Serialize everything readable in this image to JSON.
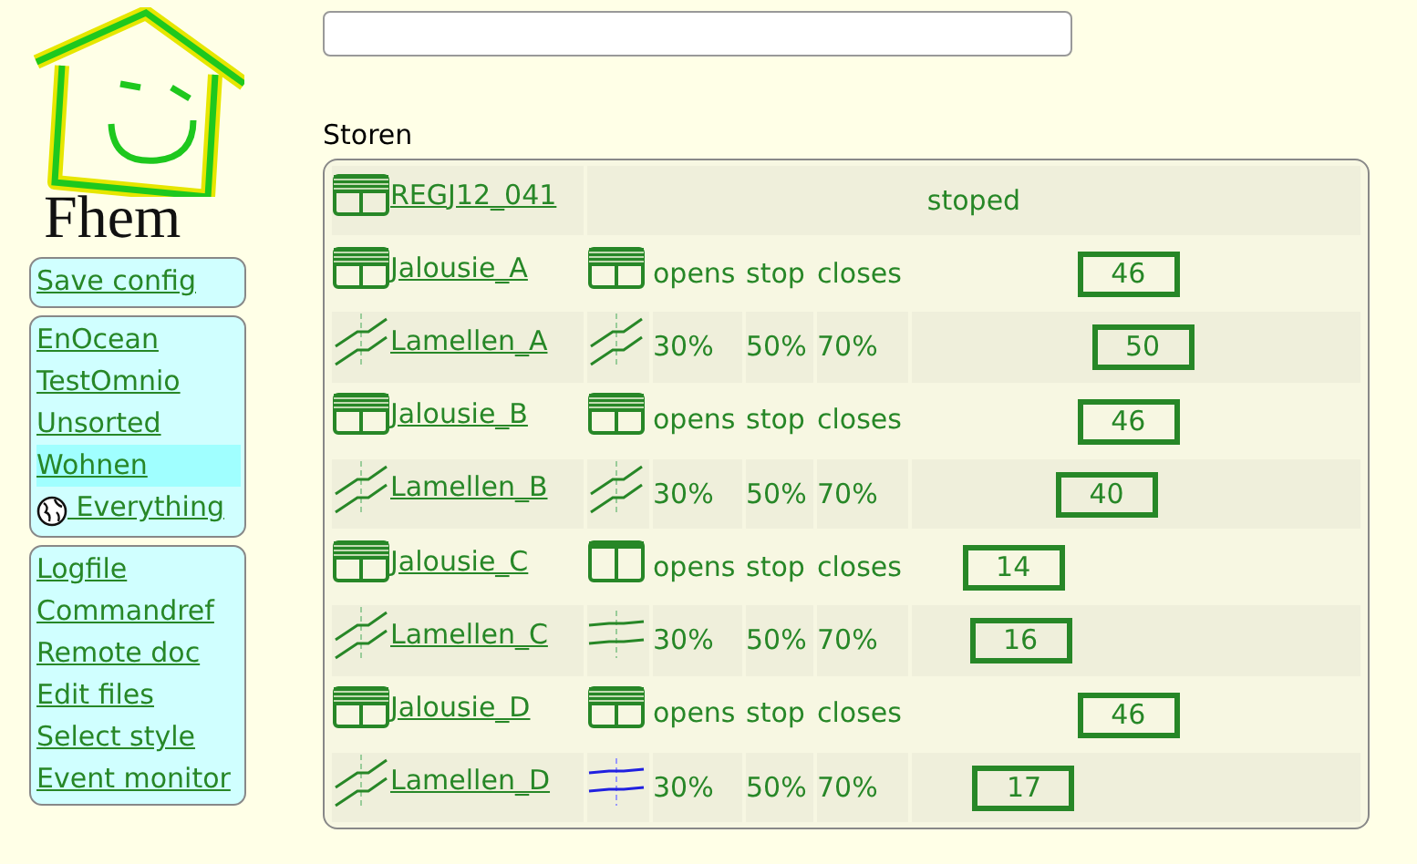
{
  "logo": {
    "text": "Fhem"
  },
  "search_field": {
    "kind": "text"
  },
  "menu_groups": [
    [
      {
        "label": "Save config",
        "kind": "link",
        "selected": false
      }
    ],
    [
      {
        "label": "EnOcean",
        "kind": "link",
        "selected": false
      },
      {
        "label": "TestOmnio",
        "kind": "link",
        "selected": false
      },
      {
        "label": "Unsorted",
        "kind": "link",
        "selected": false
      },
      {
        "label": "Wohnen",
        "kind": "link",
        "selected": true
      },
      {
        "label": " Everything",
        "kind": "globe-link",
        "selected": false
      }
    ],
    [
      {
        "label": "Logfile",
        "kind": "link",
        "selected": false
      },
      {
        "label": "Commandref",
        "kind": "link",
        "selected": false
      },
      {
        "label": "Remote doc",
        "kind": "link",
        "selected": false
      },
      {
        "label": "Edit files",
        "kind": "link",
        "selected": false
      },
      {
        "label": "Select style",
        "kind": "link",
        "selected": false
      },
      {
        "label": "Event monitor",
        "kind": "link",
        "selected": false
      }
    ]
  ],
  "room": {
    "title": "Storen",
    "rows": [
      {
        "kind": "status",
        "name": " REGJ12_041",
        "status": "stoped"
      },
      {
        "kind": "jalousie",
        "name": " Jalousie_A",
        "closed": true,
        "commands": [
          "opens",
          "stop",
          "closes"
        ],
        "slider": {
          "level": 0.46,
          "reading": "46"
        }
      },
      {
        "kind": "lamellen",
        "name": " Lamellen_A",
        "open": false,
        "moving": false,
        "commands": [
          "30%",
          "50%",
          "70%"
        ],
        "slider": {
          "level": 0.5,
          "reading": "50"
        }
      },
      {
        "kind": "jalousie",
        "name": " Jalousie_B",
        "closed": true,
        "commands": [
          "opens",
          "stop",
          "closes"
        ],
        "slider": {
          "level": 0.46,
          "reading": "46"
        }
      },
      {
        "kind": "lamellen",
        "name": " Lamellen_B",
        "open": false,
        "moving": false,
        "commands": [
          "30%",
          "50%",
          "70%"
        ],
        "slider": {
          "level": 0.4,
          "reading": "40"
        }
      },
      {
        "kind": "jalousie",
        "name": " Jalousie_C",
        "closed": false,
        "commands": [
          "opens",
          "stop",
          "closes"
        ],
        "slider": {
          "level": 0.14,
          "reading": "14"
        }
      },
      {
        "kind": "lamellen",
        "name": " Lamellen_C",
        "open": true,
        "moving": false,
        "commands": [
          "30%",
          "50%",
          "70%"
        ],
        "slider": {
          "level": 0.16,
          "reading": "16"
        }
      },
      {
        "kind": "jalousie",
        "name": " Jalousie_D",
        "closed": true,
        "commands": [
          "opens",
          "stop",
          "closes"
        ],
        "slider": {
          "level": 0.46,
          "reading": "46"
        }
      },
      {
        "kind": "lamellen",
        "name": " Lamellen_D",
        "open": true,
        "moving": true,
        "commands": [
          "30%",
          "50%",
          "70%"
        ],
        "slider": {
          "level": 0.17,
          "reading": "17"
        }
      }
    ]
  }
}
